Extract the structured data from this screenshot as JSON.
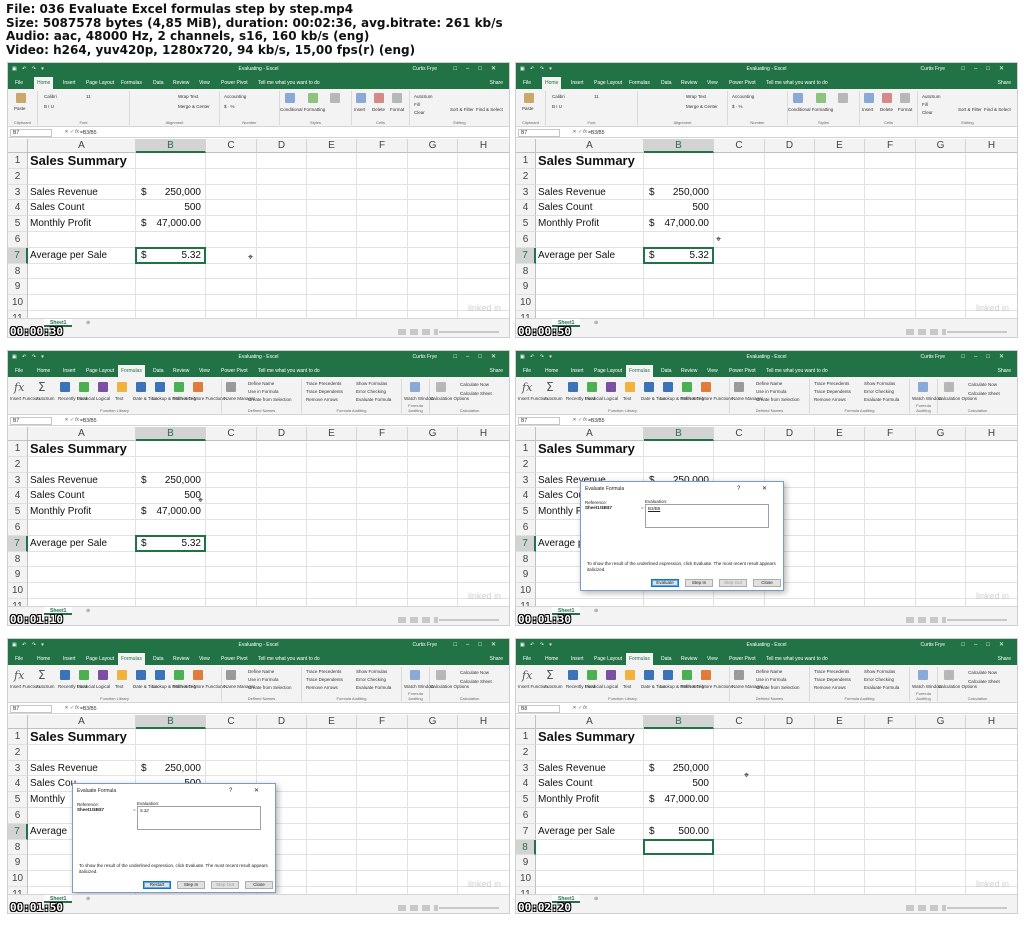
{
  "file_info": {
    "line1": "File: 036 Evaluate Excel formulas step by step.mp4",
    "line2": "Size: 5087578 bytes (4,85 MiB), duration: 00:02:36, avg.bitrate: 261 kb/s",
    "line3": "Audio: aac, 48000 Hz, 2 channels, s16, 160 kb/s (eng)",
    "line4": "Video: h264, yuv420p, 1280x720, 94 kb/s, 15,00 fps(r) (eng)"
  },
  "excel": {
    "window_title": "Evaluating - Excel",
    "user": "Curtis Frye",
    "tabs": [
      "File",
      "Home",
      "Insert",
      "Page Layout",
      "Formulas",
      "Data",
      "Review",
      "View",
      "Power Pivot"
    ],
    "tell_me": "Tell me what you want to do",
    "share": "Share",
    "sheet_tab": "Sheet1",
    "columns": [
      "A",
      "B",
      "C",
      "D",
      "E",
      "F",
      "G",
      "H"
    ],
    "rows": [
      "1",
      "2",
      "3",
      "4",
      "5",
      "6",
      "7",
      "8",
      "9",
      "10",
      "11"
    ],
    "cells": {
      "a1": "Sales Summary",
      "a3": "Sales Revenue",
      "a4": "Sales Count",
      "a5": "Monthly Profit",
      "a7": "Average per Sale",
      "b3_sym": "$",
      "b3_val": "250,000",
      "b4_val": "500",
      "b5_sym": "$",
      "b5_val": "47,000.00",
      "b7_sym": "$",
      "b7_val": "5.32",
      "b7_val_fixed": "500.00",
      "a3_cut": "Sales Revenue",
      "a4_cut": "Sales Cou",
      "a5_cut": "Monthly",
      "a7_cut": "Average"
    },
    "home_ribbon": {
      "clipboard": "Clipboard",
      "paste": "Paste",
      "font_name": "Calibri",
      "font_size": "11",
      "font": "Font",
      "alignment": "Alignment",
      "wrap_text": "Wrap Text",
      "merge_center": "Merge & Center",
      "number_format": "Accounting",
      "number": "Number",
      "conditional_formatting": "Conditional Formatting",
      "format_as_table": "Format as Table",
      "cell_styles": "Cell Styles",
      "styles": "Styles",
      "insert": "Insert",
      "delete": "Delete",
      "format": "Format",
      "cells_group": "Cells",
      "autosum": "AutoSum",
      "fill": "Fill",
      "clear": "Clear",
      "sort_filter": "Sort & Filter",
      "find_select": "Find & Select",
      "editing": "Editing"
    },
    "formulas_ribbon": {
      "insert_function": "Insert Function",
      "autosum": "AutoSum",
      "recently_used": "Recently Used",
      "financial": "Financial",
      "logical": "Logical",
      "text": "Text",
      "date_time": "Date & Time",
      "lookup_reference": "Lookup & Reference",
      "math_trig": "Math & Trig",
      "more_functions": "More Functions",
      "function_library": "Function Library",
      "name_manager": "Name Manager",
      "define_name": "Define Name",
      "use_in_formula": "Use in Formula",
      "create_from_selection": "Create from Selection",
      "defined_names": "Defined Names",
      "trace_precedents": "Trace Precedents",
      "trace_dependents": "Trace Dependents",
      "remove_arrows": "Remove Arrows",
      "show_formulas": "Show Formulas",
      "error_checking": "Error Checking",
      "evaluate_formula": "Evaluate Formula",
      "formula_auditing": "Formula Auditing",
      "watch_window": "Watch Window",
      "calculation_options": "Calculation Options",
      "calculate_now": "Calculate Now",
      "calculate_sheet": "Calculate Sheet",
      "calculation": "Calculation"
    },
    "dialog": {
      "title": "Evaluate Formula",
      "reference_label": "Reference:",
      "reference_value": "Sheet1!$B$7",
      "evaluation_label": "Evaluation:",
      "equals": "=",
      "help_text": "To show the result of the underlined expression, click Evaluate. The most recent result appears italicized.",
      "evaluate": "Evaluate",
      "restart": "Restart",
      "step_in": "Step In",
      "step_out": "Step Out",
      "close": "Close",
      "help_btn": "?",
      "close_x": "✕",
      "formula_initial": "B3/B5",
      "formula_result": "5.32"
    }
  },
  "frames": [
    {
      "timestamp": "00:00:30",
      "ribbon": "home",
      "namebox": "B7",
      "formula": "=B3/B5",
      "selected_col": "B",
      "selected_row": "7",
      "b7": "5.32"
    },
    {
      "timestamp": "00:00:50",
      "ribbon": "home",
      "namebox": "B7",
      "formula": "=B3/B5",
      "selected_col": "B",
      "selected_row": "7",
      "b7": "5.32"
    },
    {
      "timestamp": "00:01:10",
      "ribbon": "formulas",
      "namebox": "B7",
      "formula": "=B3/B5",
      "selected_col": "B",
      "selected_row": "7",
      "b7": "5.32"
    },
    {
      "timestamp": "00:01:30",
      "ribbon": "formulas",
      "namebox": "B7",
      "formula": "=B3/B5",
      "selected_col": "B",
      "selected_row": "7",
      "dialog": "initial"
    },
    {
      "timestamp": "00:01:50",
      "ribbon": "formulas",
      "namebox": "B7",
      "formula": "=B3/B5",
      "selected_col": "B",
      "selected_row": "7",
      "dialog": "result"
    },
    {
      "timestamp": "00:02:20",
      "ribbon": "formulas",
      "namebox": "B8",
      "formula": "",
      "selected_col": "B",
      "selected_row": "8",
      "b7": "500.00"
    }
  ],
  "colors": {
    "excel_green": "#217346",
    "ribbon_bg": "#f3f3f3",
    "selection": "#217346"
  }
}
